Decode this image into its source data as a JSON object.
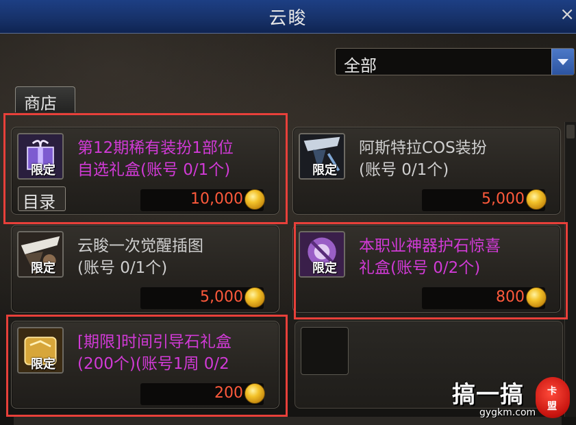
{
  "window": {
    "title": "云睃",
    "close_label": "×"
  },
  "filter": {
    "selected": "全部"
  },
  "tabs": {
    "shop_label": "商店",
    "catalog_label": "目录"
  },
  "icon_badge": "限定",
  "items": [
    {
      "name": "第12期稀有装扮1部位\n自选礼盒(账号 0/1个)",
      "price": "10,000",
      "name_color": "purple"
    },
    {
      "name": "阿斯特拉COS装扮\n(账号 0/1个)",
      "price": "5,000",
      "name_color": "grey"
    },
    {
      "name": "云睃一次觉醒插图\n(账号 0/1个)",
      "price": "5,000",
      "name_color": "grey"
    },
    {
      "name": "本职业神器护石惊喜\n礼盒(账号 0/2个)",
      "price": "800",
      "name_color": "purple"
    },
    {
      "name": "[期限]时间引导石礼盒\n(200个)(账号1周 0/2",
      "price": "200",
      "name_color": "purple"
    }
  ],
  "watermark": {
    "brand": "搞一搞",
    "url": "gygkm.com",
    "seal_top": "卡",
    "seal_bottom": "盟"
  },
  "colors": {
    "highlight": "#e8403a",
    "purple_text": "#d13ad6",
    "price_text": "#ff5a3c",
    "titlebar": "#17326a"
  }
}
